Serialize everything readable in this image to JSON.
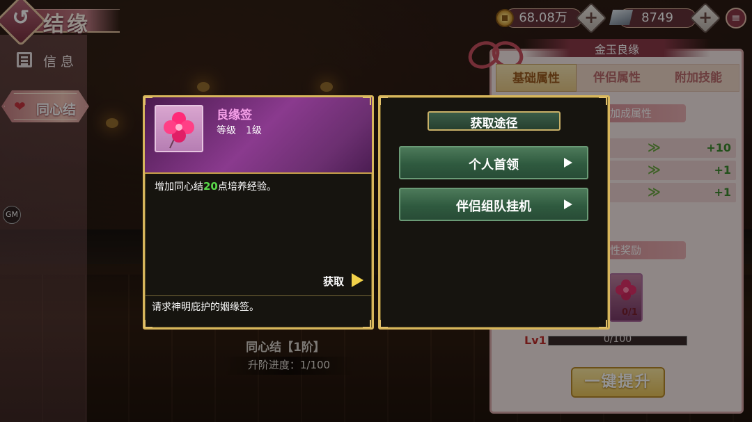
{
  "header": {
    "title": "结缘",
    "back_glyph": "↺",
    "gold_amount": "68.08万",
    "silver_amount": "8749",
    "plus": "+",
    "menu_glyph": "≡"
  },
  "sidebar": {
    "info_label": "信息",
    "tab_label": "同心结",
    "tab_heart": "❤",
    "gm_label": "GM"
  },
  "stage": {
    "title": "同心结【1阶】",
    "progress": "升阶进度：1/100"
  },
  "right_panel": {
    "title": "金玉良缘",
    "tabs": [
      {
        "label": "基础属性"
      },
      {
        "label": "伴侣属性"
      },
      {
        "label": "附加技能"
      }
    ],
    "bonus_header": "加成属性",
    "stats": [
      {
        "arrow": "≫",
        "value": "+10"
      },
      {
        "arrow": "≫",
        "value": "+1"
      },
      {
        "arrow": "≫",
        "value": "+1"
      }
    ],
    "reward_header": "性奖励",
    "reward_count": "0/1",
    "level_label": "Lv1",
    "level_progress": "0/100",
    "level_fill": 0,
    "upgrade_button": "一键提升"
  },
  "item_popup": {
    "name": "良缘签",
    "level": "等级　1级",
    "desc_before": "增加同心结",
    "desc_number": "20",
    "desc_after": "点培养经验。",
    "get_label": "获取",
    "flavor": "请求神明庇护的姻缘签。"
  },
  "acquire_popup": {
    "title": "获取途径",
    "options": [
      {
        "label": "个人首领"
      },
      {
        "label": "伴侣组队挂机"
      }
    ]
  },
  "colors": {
    "gold_border": "#d7b65c",
    "item_name": "#f5a0e8",
    "highlight_green": "#59d84a",
    "stat_green": "#3b8a2e",
    "button_green": "#2f5a3f"
  }
}
